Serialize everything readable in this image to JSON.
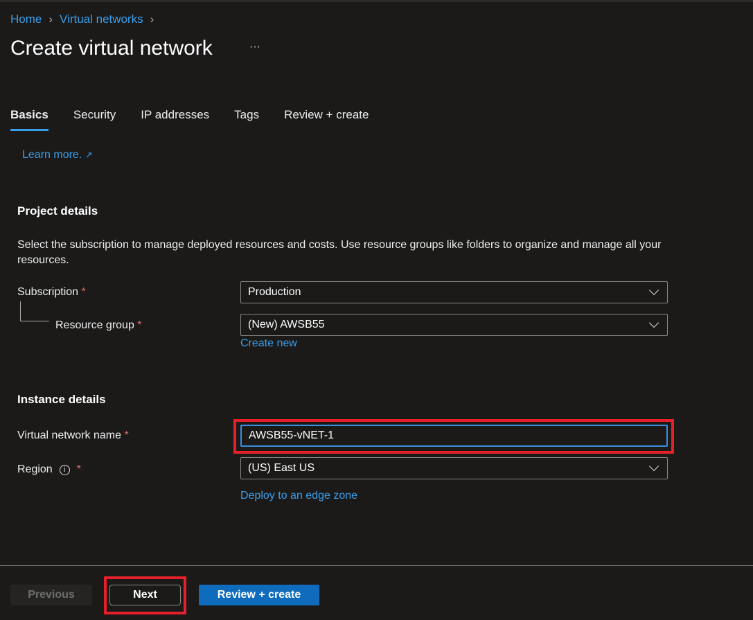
{
  "breadcrumb": [
    {
      "label": "Home"
    },
    {
      "label": "Virtual networks"
    }
  ],
  "title": "Create virtual network",
  "more_label": "···",
  "tabs": [
    {
      "label": "Basics",
      "active": true
    },
    {
      "label": "Security"
    },
    {
      "label": "IP addresses"
    },
    {
      "label": "Tags"
    },
    {
      "label": "Review + create"
    }
  ],
  "learn_more": "Learn more.",
  "project": {
    "heading": "Project details",
    "description": "Select the subscription to manage deployed resources and costs. Use resource groups like folders to organize and manage all your resources.",
    "subscription_label": "Subscription",
    "subscription_value": "Production",
    "rg_label": "Resource group",
    "rg_value": "(New) AWSB55",
    "create_new": "Create new"
  },
  "instance": {
    "heading": "Instance details",
    "vnet_label": "Virtual network name",
    "vnet_value": "AWSB55-vNET-1",
    "region_label": "Region",
    "region_value": "(US) East US",
    "edge_zone": "Deploy to an edge zone"
  },
  "required_mark": "*",
  "footer": {
    "previous": "Previous",
    "next": "Next",
    "review": "Review + create"
  },
  "colors": {
    "accent": "#0f6cbd",
    "link": "#3a9eea",
    "highlight": "#e5202a"
  }
}
